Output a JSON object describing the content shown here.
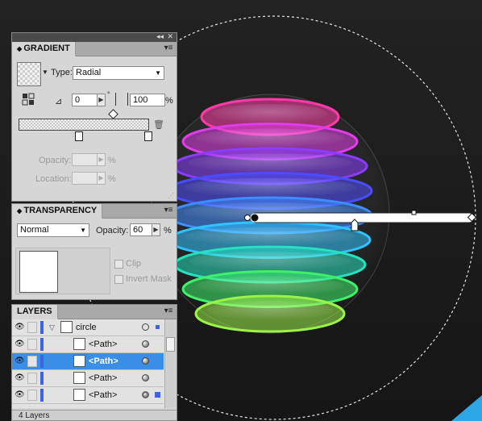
{
  "colors": {
    "artboard": "#1b1b1b",
    "panel": "#d6d6d6",
    "selection": "#3a8ee6",
    "layer_color": "#3f62e0",
    "bands": [
      "#ff3aa8",
      "#e03ce8",
      "#8a3cff",
      "#4a4cff",
      "#3e8dff",
      "#2fc3ff",
      "#27e0c0",
      "#3ef06a",
      "#9cf24a"
    ]
  },
  "panel_controls": {
    "collapse_glyph": "◂◂",
    "close_glyph": "✕",
    "menu_glyph": "▾≡"
  },
  "gradient": {
    "title": "GRADIENT",
    "type_label": "Type:",
    "type_value": "Radial",
    "angle_value": "0",
    "degree_symbol": "°",
    "aspect_value": "100",
    "aspect_unit": "%",
    "opacity_label": "Opacity:",
    "opacity_value": "",
    "opacity_unit": "%",
    "location_label": "Location:",
    "location_value": "",
    "location_unit": "%"
  },
  "transparency": {
    "title": "TRANSPARENCY",
    "blend_mode": "Normal",
    "opacity_label": "Opacity:",
    "opacity_value": "60",
    "opacity_unit": "%",
    "clip_label": "Clip",
    "invert_mask_label": "Invert Mask"
  },
  "layers": {
    "title": "LAYERS",
    "footer_count": "4 Layers",
    "rows": [
      {
        "name": "circle",
        "selected": false
      },
      {
        "name": "<Path>",
        "selected": false
      },
      {
        "name": "<Path>",
        "selected": true
      },
      {
        "name": "<Path>",
        "selected": false
      },
      {
        "name": "<Path>",
        "selected": false
      }
    ]
  }
}
